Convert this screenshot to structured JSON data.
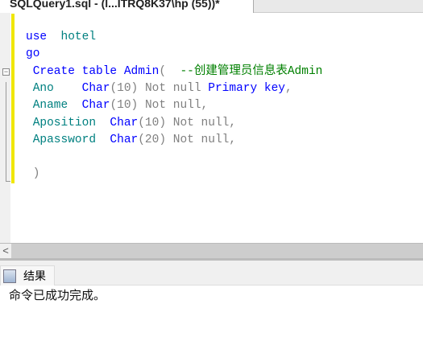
{
  "tab": {
    "title": "SQLQuery1.sql - (l...ITRQ8K37\\hp (55))*"
  },
  "code": [
    [
      {
        "t": "use  ",
        "c": "kw"
      },
      {
        "t": "hotel",
        "c": "id"
      }
    ],
    [
      {
        "t": "go",
        "c": "kw"
      }
    ],
    [
      {
        "t": " Create table ",
        "c": "kw"
      },
      {
        "t": "Admin",
        "c": "ty"
      },
      {
        "t": "(  ",
        "c": "gr"
      },
      {
        "t": "--创建管理员信息表Admin",
        "c": "cm"
      }
    ],
    [
      {
        "t": " Ano    ",
        "c": "id"
      },
      {
        "t": "Char",
        "c": "ty"
      },
      {
        "t": "(10) Not null ",
        "c": "gr"
      },
      {
        "t": "Primary key",
        "c": "kw"
      },
      {
        "t": ",",
        "c": "gr"
      }
    ],
    [
      {
        "t": " Aname  ",
        "c": "id"
      },
      {
        "t": "Char",
        "c": "ty"
      },
      {
        "t": "(10) Not null,",
        "c": "gr"
      }
    ],
    [
      {
        "t": " Aposition  ",
        "c": "id"
      },
      {
        "t": "Char",
        "c": "ty"
      },
      {
        "t": "(10) Not null,",
        "c": "gr"
      }
    ],
    [
      {
        "t": " Apassword  ",
        "c": "id"
      },
      {
        "t": "Char",
        "c": "ty"
      },
      {
        "t": "(20) Not null,",
        "c": "gr"
      }
    ],
    [],
    [
      {
        "t": " )",
        "c": "gr"
      }
    ]
  ],
  "results": {
    "tab_label": "结果",
    "message": "命令已成功完成。"
  },
  "scroll": {
    "left_arrow": "<"
  }
}
